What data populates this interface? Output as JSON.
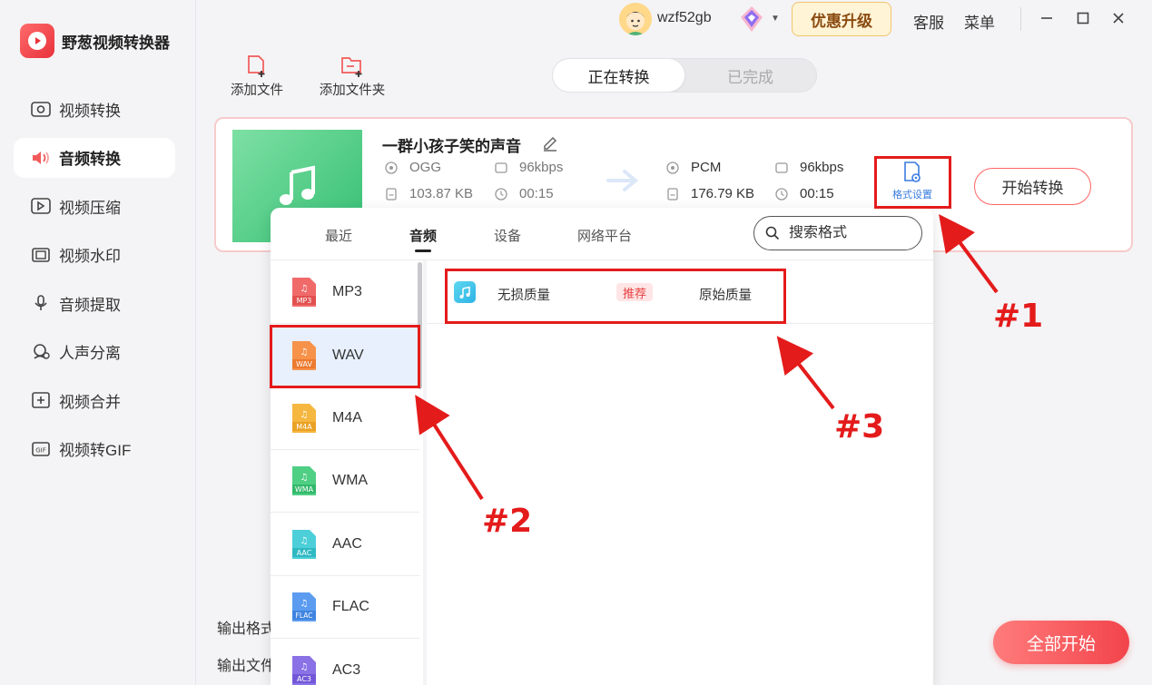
{
  "app": {
    "title": "野葱视频转换器"
  },
  "sidebar": {
    "items": [
      {
        "label": "视频转换",
        "icon": "video-convert-icon",
        "active": false
      },
      {
        "label": "音频转换",
        "icon": "audio-convert-icon",
        "active": true
      },
      {
        "label": "视频压缩",
        "icon": "video-compress-icon",
        "active": false
      },
      {
        "label": "视频水印",
        "icon": "video-watermark-icon",
        "active": false
      },
      {
        "label": "音频提取",
        "icon": "audio-extract-icon",
        "active": false
      },
      {
        "label": "人声分离",
        "icon": "voice-separate-icon",
        "active": false
      },
      {
        "label": "视频合并",
        "icon": "video-merge-icon",
        "active": false
      },
      {
        "label": "视频转GIF",
        "icon": "video-gif-icon",
        "active": false
      }
    ]
  },
  "topbar": {
    "username": "wzf52gb",
    "upgrade_label": "优惠升级",
    "service_label": "客服",
    "menu_label": "菜单"
  },
  "toolbar": {
    "add_file": "添加文件",
    "add_folder": "添加文件夹"
  },
  "tabs": {
    "converting": "正在转换",
    "done": "已完成"
  },
  "file": {
    "name": "一群小孩子笑的声音",
    "source": {
      "format": "OGG",
      "bitrate": "96kbps",
      "size": "103.87 KB",
      "duration": "00:15"
    },
    "target": {
      "format": "PCM",
      "bitrate": "96kbps",
      "size": "176.79 KB",
      "duration": "00:15"
    },
    "format_settings_label": "格式设置",
    "start_label": "开始转换"
  },
  "bottom": {
    "output_format_label": "输出格式",
    "output_file_label": "输出文件",
    "start_all_label": "全部开始"
  },
  "popup": {
    "tabs": [
      "最近",
      "音频",
      "设备",
      "网络平台"
    ],
    "active_tab": "音频",
    "search_placeholder": "搜索格式",
    "formats": [
      {
        "name": "MP3",
        "color": "#f06a6a"
      },
      {
        "name": "WAV",
        "color": "#f6924a"
      },
      {
        "name": "M4A",
        "color": "#f5b740"
      },
      {
        "name": "WMA",
        "color": "#4fcf84"
      },
      {
        "name": "AAC",
        "color": "#4ccfd8"
      },
      {
        "name": "FLAC",
        "color": "#5b9cf0"
      },
      {
        "name": "AC3",
        "color": "#8a72e6"
      }
    ],
    "selected_format": "WAV",
    "quality": {
      "name": "无损质量",
      "badge": "推荐",
      "desc": "原始质量"
    }
  },
  "annotations": {
    "a1": "#1",
    "a2": "#2",
    "a3": "#3"
  }
}
